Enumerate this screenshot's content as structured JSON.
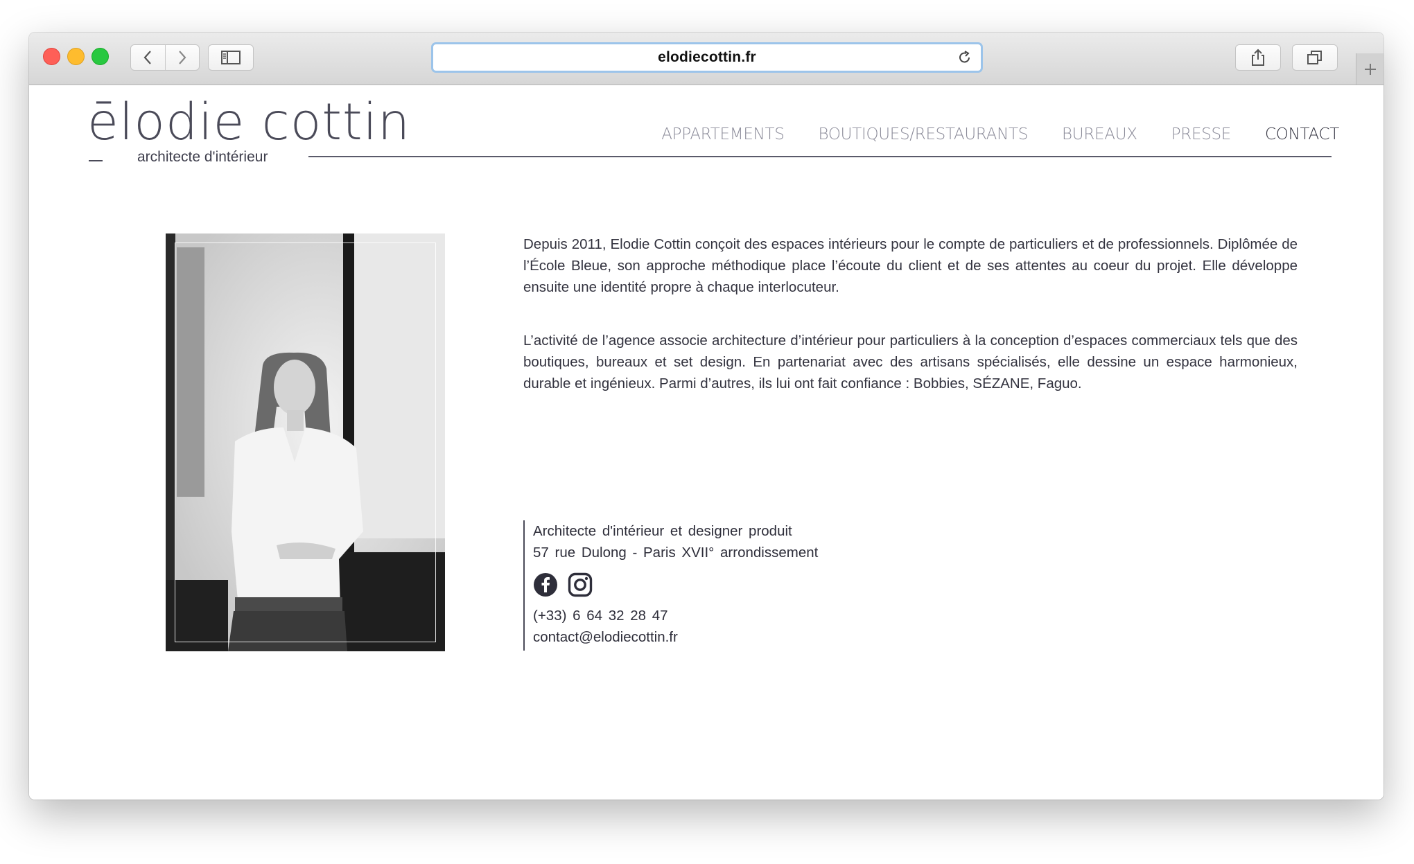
{
  "browser": {
    "url": "elodiecottin.fr"
  },
  "logo": {
    "name": "ēlodie cottin",
    "tagline": "architecte d'intérieur"
  },
  "nav": {
    "items": [
      {
        "label": "APPARTEMENTS"
      },
      {
        "label": "BOUTIQUES/RESTAURANTS"
      },
      {
        "label": "BUREAUX"
      },
      {
        "label": "PRESSE"
      },
      {
        "label": "CONTACT"
      }
    ],
    "active": "CONTACT"
  },
  "bio": {
    "paragraphs": [
      "Depuis 2011, Elodie Cottin conçoit des espaces intérieurs pour le compte de particuliers et de professionnels. Diplômée de l’École Bleue, son approche méthodique place l’écoute du client et de ses attentes au coeur du projet. Elle développe ensuite une identité propre à chaque interlocuteur.",
      "L’activité de l’agence associe architecture d’intérieur pour particuliers à la conception d’espaces commerciaux tels que des boutiques, bureaux et set design. En partenariat avec des artisans spécialisés, elle dessine un espace harmonieux, durable et ingénieux. Parmi d’autres, ils lui ont fait confiance : Bobbies, SÉZANE, Faguo."
    ]
  },
  "contact": {
    "role": "Architecte d'intérieur et designer produit",
    "address": "57 rue Dulong - Paris XVII° arrondissement",
    "phone": "(+33) 6 64 32 28 47",
    "email": "contact@elodiecottin.fr"
  },
  "icons": {
    "facebook": "facebook-icon",
    "instagram": "instagram-icon"
  },
  "colors": {
    "text": "#33333f",
    "nav_inactive": "#8a8a98",
    "url_focus": "#9cc4ea"
  }
}
